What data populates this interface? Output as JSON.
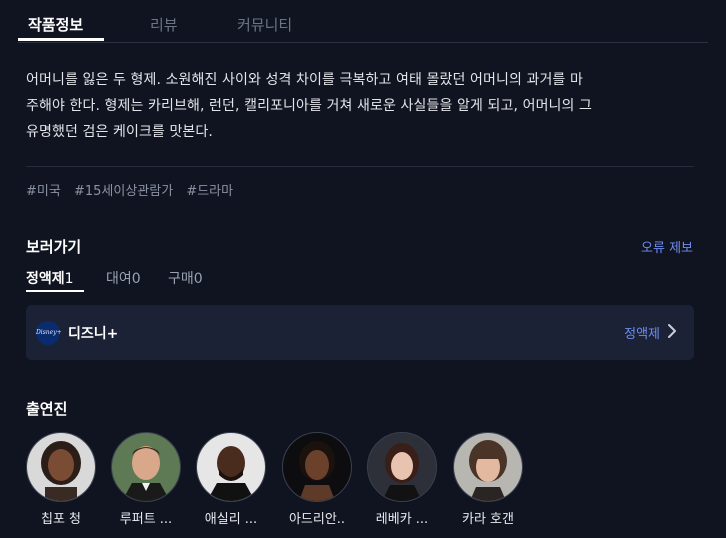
{
  "tabs": [
    {
      "label": "작품정보",
      "active": true
    },
    {
      "label": "리뷰",
      "active": false
    },
    {
      "label": "커뮤니티",
      "active": false
    }
  ],
  "synopsis": {
    "lines": [
      "어머니를 잃은 두 형제. 소원해진 사이와 성격 차이를 극복하고 여태 몰랐던 어머니의 과거를 마",
      "주해야 한다. 형제는 카리브해, 런던, 캘리포니아를 거쳐 새로운 사실들을 알게 되고, 어머니의 그",
      "유명했던 검은 케이크를 맛본다."
    ]
  },
  "tags": [
    "#미국",
    "#15세이상관람가",
    "#드라마"
  ],
  "where_to_watch": {
    "title": "보러가기",
    "report_label": "오류 제보",
    "tabs": [
      {
        "label": "정액제",
        "count": "1",
        "active": true
      },
      {
        "label": "대여",
        "count": "0",
        "active": false
      },
      {
        "label": "구매",
        "count": "0",
        "active": false
      }
    ],
    "provider": {
      "logo_text": "Disney+",
      "name": "디즈니+",
      "type": "정액제",
      "logo_color": "#0a2b6e"
    }
  },
  "cast": {
    "title": "출연진",
    "members": [
      {
        "name": "칩포 청"
      },
      {
        "name": "루퍼트 ..."
      },
      {
        "name": "애실리 ..."
      },
      {
        "name": "아드리안.."
      },
      {
        "name": "레베카 ..."
      },
      {
        "name": "카라 호갠"
      }
    ]
  },
  "colors": {
    "background": "#0f1420",
    "accent": "#6f8cf0",
    "card": "#1b2236"
  }
}
